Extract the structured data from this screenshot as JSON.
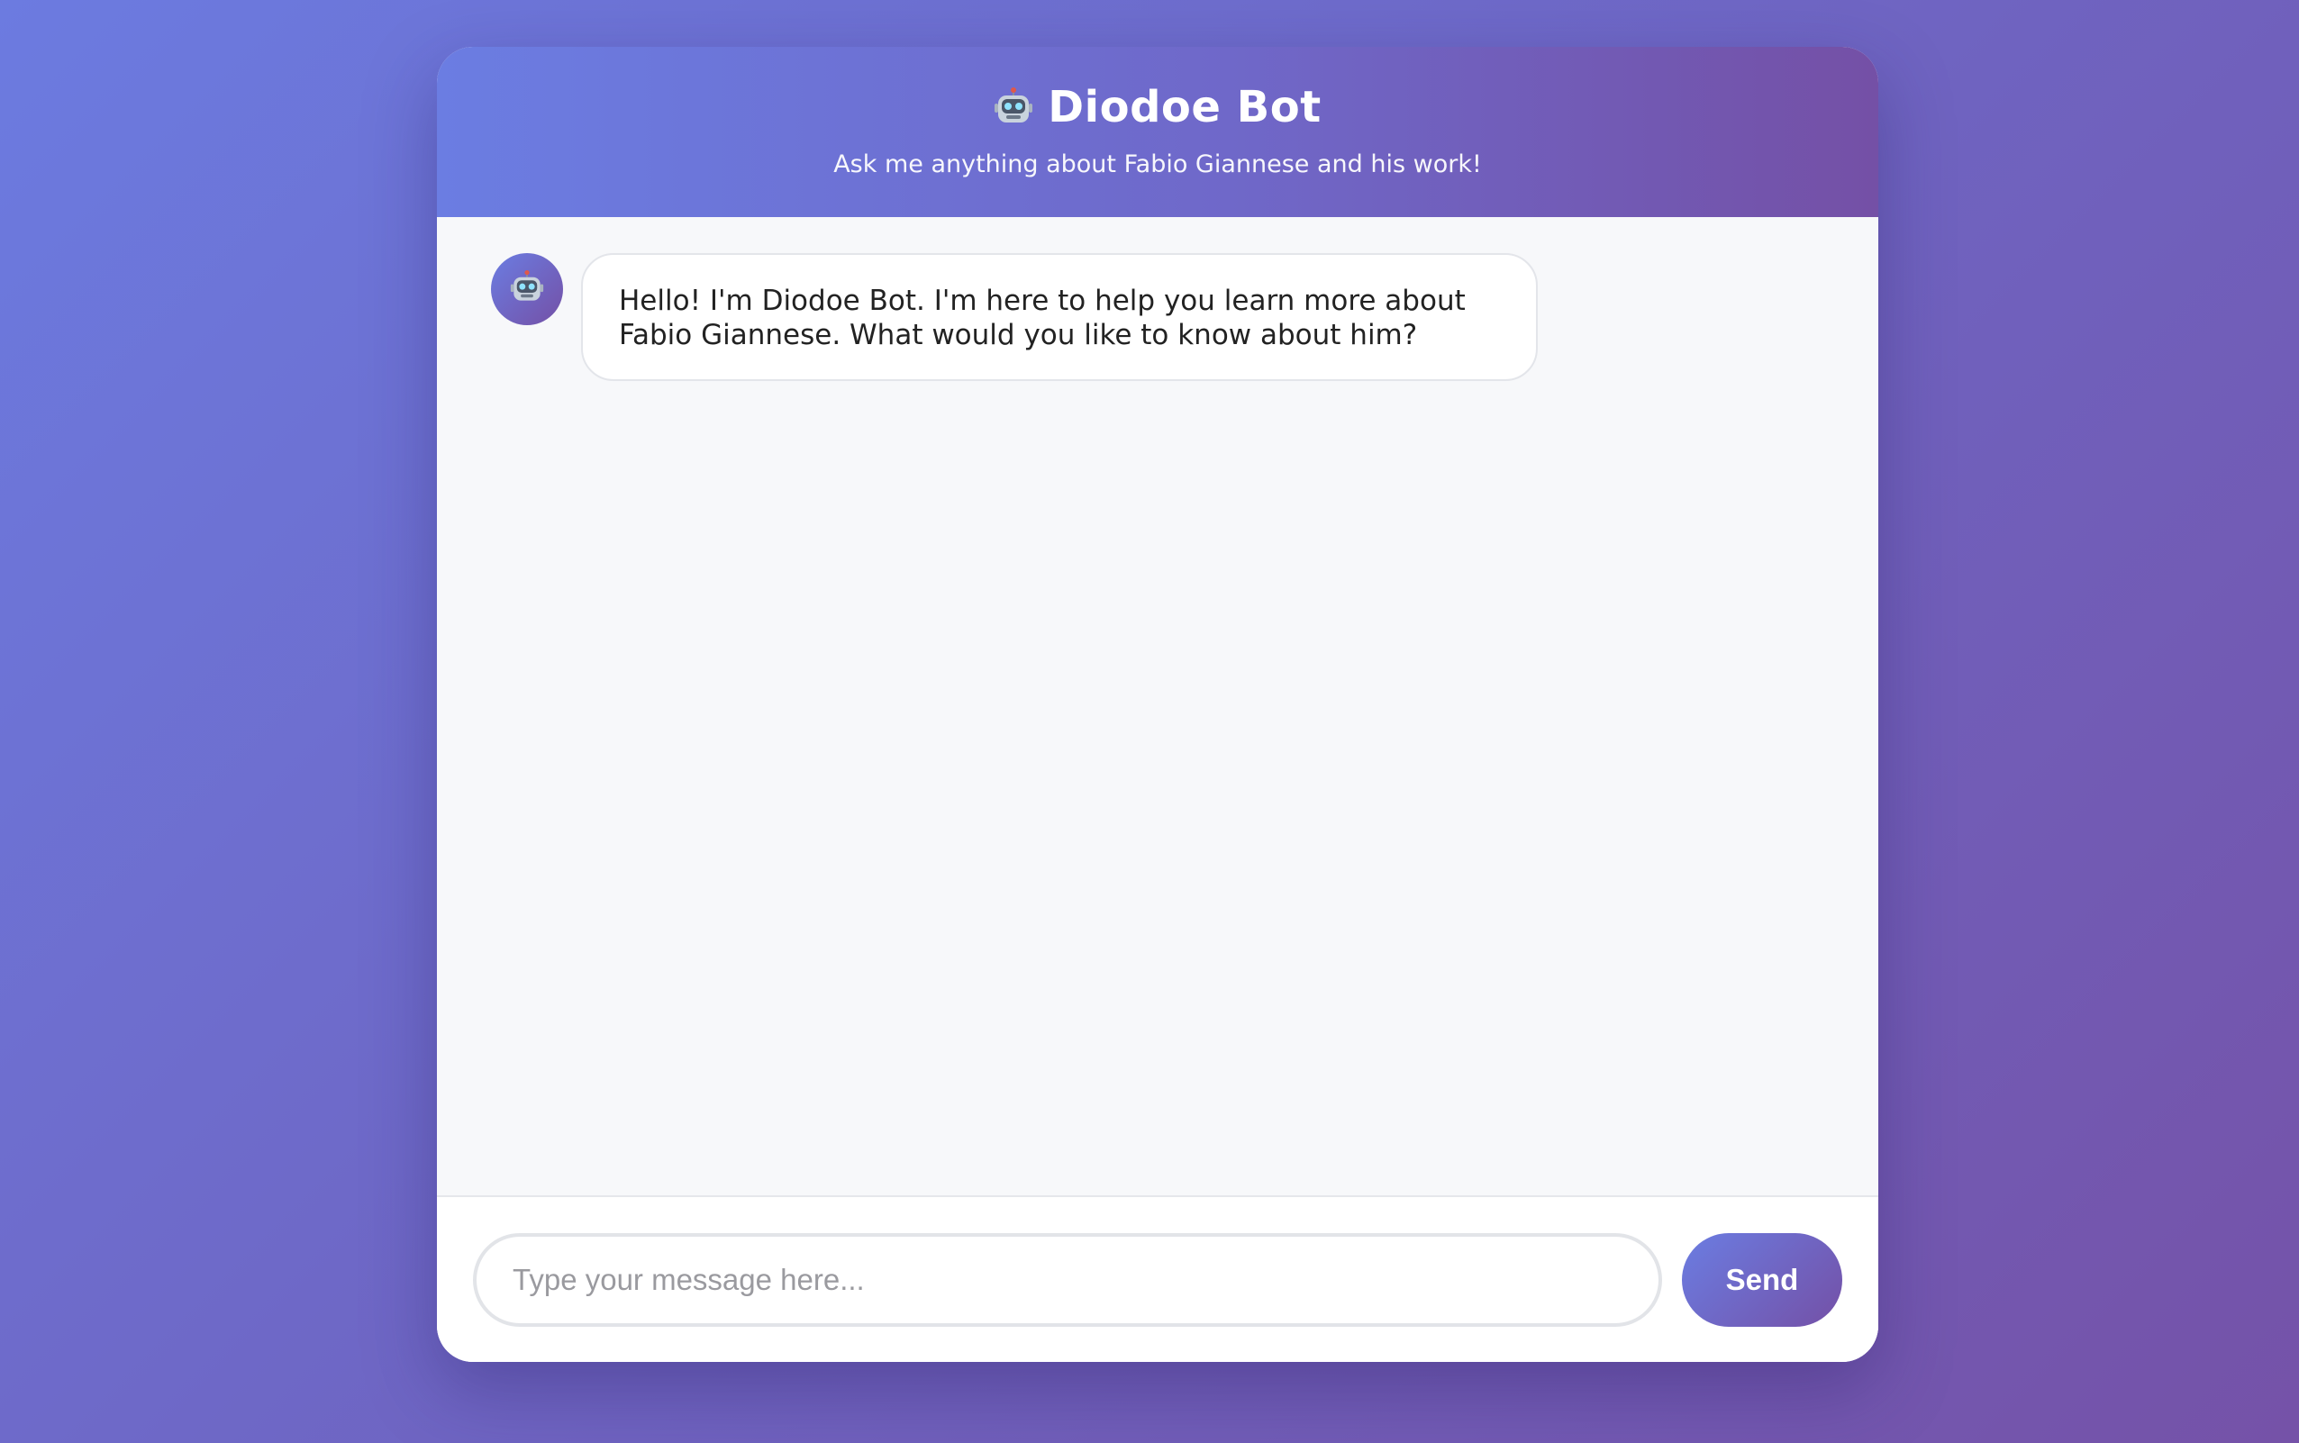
{
  "header": {
    "icon": "robot-icon",
    "title": "Diodoe Bot",
    "subtitle": "Ask me anything about Fabio Giannese and his work!"
  },
  "messages": [
    {
      "sender": "bot",
      "avatar_icon": "robot-icon",
      "text": "Hello! I'm Diodoe Bot. I'm here to help you learn more about Fabio Giannese. What would you like to know about him?"
    }
  ],
  "composer": {
    "placeholder": "Type your message here...",
    "value": "",
    "send_label": "Send"
  },
  "colors": {
    "accent_start": "#6b7de2",
    "accent_end": "#7450a6",
    "messages_bg": "#f7f8fa"
  }
}
